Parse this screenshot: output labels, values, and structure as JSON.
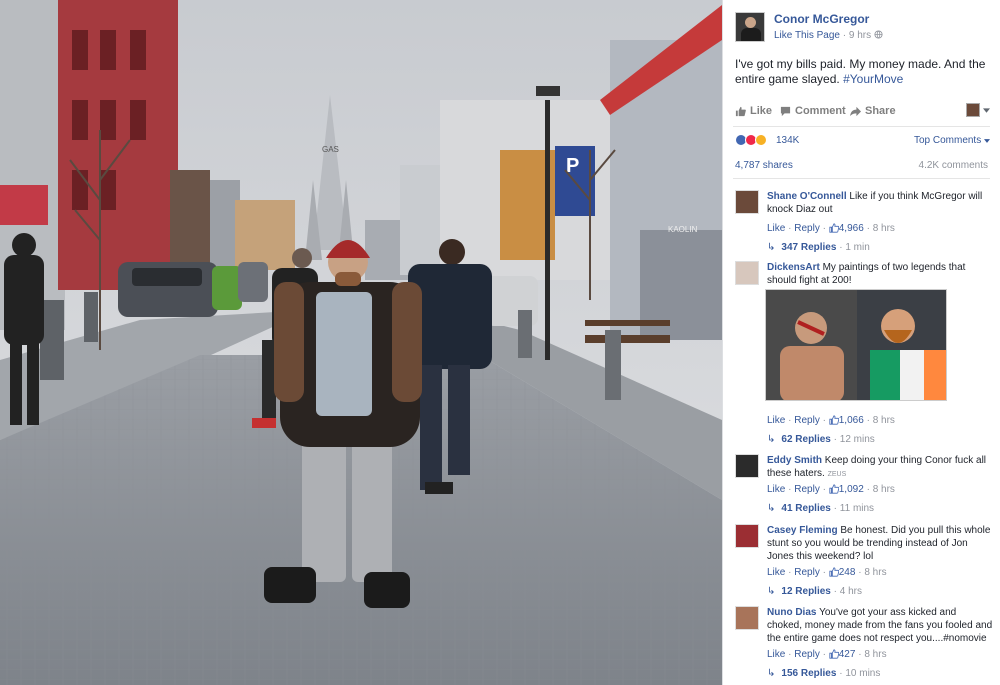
{
  "page": {
    "name": "Conor McGregor",
    "like_page": "Like This Page",
    "time": "9 hrs",
    "separator": " · "
  },
  "post": {
    "text": "I've got my bills paid. My money made. And the entire game slayed.",
    "hashtag": "#YourMove"
  },
  "actions": {
    "like": "Like",
    "comment": "Comment",
    "share": "Share"
  },
  "reactions": {
    "count": "134K",
    "top_comments": "Top Comments",
    "shares": "4,787 shares",
    "comments": "4.2K comments"
  },
  "photo": {
    "sign_letter": "P",
    "church_sign": "GAS",
    "shop_sign": "KAOLIN"
  },
  "labels": {
    "like": "Like",
    "reply": "Reply",
    "dot": "·"
  },
  "comments": [
    {
      "author": "Shane O'Connell",
      "text": "Like if you think McGregor will knock Diaz out",
      "likes": "4,966",
      "time": "8 hrs",
      "replies": "347 Replies",
      "replies_time": "1 min"
    },
    {
      "author": "DickensArt",
      "text": "My paintings of two legends that should fight at 200!",
      "likes": "1,066",
      "time": "8 hrs",
      "replies": "62 Replies",
      "replies_time": "12 mins"
    },
    {
      "author": "Eddy Smith",
      "text": "Keep doing your thing Conor fuck all these haters.",
      "small": "ZEUS",
      "likes": "1,092",
      "time": "8 hrs",
      "replies": "41 Replies",
      "replies_time": "11 mins"
    },
    {
      "author": "Casey Fleming",
      "text": "Be honest. Did you pull this whole stunt so you would be trending instead of Jon Jones this weekend? lol",
      "likes": "248",
      "time": "8 hrs",
      "replies": "12 Replies",
      "replies_time": "4 hrs"
    },
    {
      "author": "Nuno Dias",
      "text": "You've got your ass kicked and choked, money made from the fans you fooled and the entire game does not respect you....",
      "hashtag": "#nomovie",
      "likes": "427",
      "time": "8 hrs",
      "replies": "156 Replies",
      "replies_time": "10 mins"
    }
  ],
  "colors": {
    "link": "#365899",
    "muted": "#90949c",
    "like_reaction": "#4267b2",
    "love_reaction": "#f0284a",
    "haha_reaction": "#f7b125"
  }
}
